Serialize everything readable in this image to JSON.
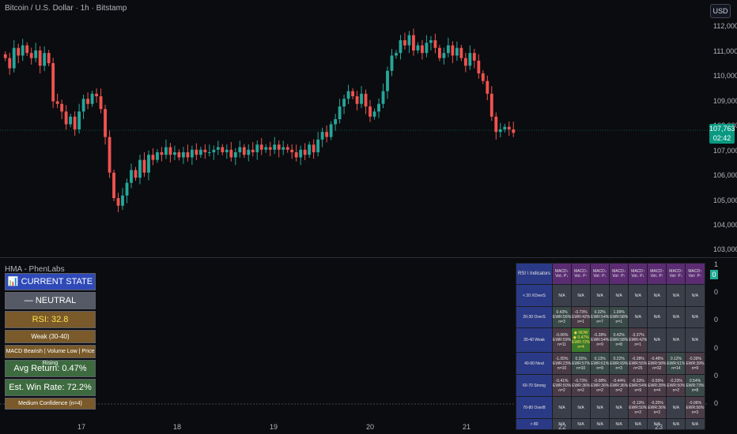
{
  "symbol": {
    "title": "Bitcoin / U.S. Dollar · 1h · Bitstamp",
    "currency": "USD"
  },
  "price_scale": {
    "ticks": [
      "112,000",
      "111,000",
      "110,000",
      "109,000",
      "108,000",
      "107,000",
      "106,000",
      "105,000",
      "104,000",
      "103,000"
    ],
    "last_price": "107,763",
    "countdown": "02:42"
  },
  "time_axis": {
    "ticks": [
      "17",
      "18",
      "19",
      "20",
      "21",
      "22",
      "23"
    ]
  },
  "indicator": {
    "title": "HMA - PhenLabs",
    "scale_ticks": [
      "1",
      "0",
      "0",
      "0",
      "0",
      "0",
      "0"
    ],
    "scale_badge": "0"
  },
  "state_panel": {
    "current_state": "📊 CURRENT STATE",
    "neutral": "— NEUTRAL",
    "rsi": "RSI: 32.8",
    "weak": "Weak (30-40)",
    "conditions": "MACD Bearish | Volume Low | Price Rising",
    "avg_return": "Avg Return: 0.47%",
    "win_rate": "Est. Win Rate: 72.2%",
    "confidence": "Medium Confidence (n=4)"
  },
  "matrix": {
    "corner": "RSI \\ Indicators",
    "columns": [
      "MACD↓ Vol↓ P↓",
      "MACD↓ Vol↓ P↑",
      "MACD↓ Vol↑ P↓",
      "MACD↓ Vol↑ P↑",
      "MACD↑ Vol↓ P↓",
      "MACD↑ Vol↓ P↑",
      "MACD↑ Vol↑ P↓",
      "MACD↑ Vol↑ P↑"
    ],
    "rows": [
      {
        "label": "< 20 XOverS",
        "cells": [
          "N/A",
          "N/A",
          "N/A",
          "N/A",
          "N/A",
          "N/A",
          "N/A",
          "N/A"
        ]
      },
      {
        "label": "20-30 OverS",
        "cells": [
          "0.43% EWR:56% n=3",
          "-0.73% EWR:42% n=1",
          "0.32% EWR:54% n=7",
          "1.99% EWR:58% n=1",
          "N/A",
          "N/A",
          "N/A",
          "N/A"
        ]
      },
      {
        "label": "30-40 Weak",
        "cells": [
          "-0.06% EWR:59% n=11",
          "◉ NOW ◉ 0.47% EWR:72% n=4",
          "-0.28% EWR:54% n=9",
          "0.42% EWR:58% n=8",
          "-3.37% EWR:42% n=1",
          "N/A",
          "N/A",
          "N/A"
        ]
      },
      {
        "label": "40-60 Neut",
        "cells": [
          "-1.05% EWR:23% n=10",
          "0.35% EWR:57% n=10",
          "0.13% EWR:61% n=9",
          "0.22% EWR:69% n=3",
          "-0.28% EWR:55% n=25",
          "-0.48% EWR:58% n=32",
          "0.12% EWR:61% n=14",
          "-0.39% EWR:39% n=9"
        ]
      },
      {
        "label": "60-70 Strong",
        "cells": [
          "-0.41% EWR:50% n=2",
          "-0.73% EWR:36% n=2",
          "-0.08% EWR:36% n=2",
          "-0.44% EWR:36% n=2",
          "-0.33% EWR:54% n=9",
          "-0.59% EWR:28% n=4",
          "-0.23% EWR:50% n=2",
          "0.54% EWR:73% n=8"
        ]
      },
      {
        "label": "70-80 OverB",
        "cells": [
          "N/A",
          "N/A",
          "N/A",
          "N/A",
          "-0.13% EWR:50% n=2",
          "-0.25% EWR:36% n=2",
          "N/A",
          "-0.06% EWR:56% n=3"
        ]
      },
      {
        "label": "> 80",
        "cells": [
          "N/A",
          "N/A",
          "N/A",
          "N/A",
          "N/A",
          "N/A",
          "N/A",
          "N/A"
        ]
      }
    ]
  },
  "colors": {
    "up": "#26a69a",
    "down": "#ef5350",
    "background": "#0b0c0f",
    "last_price": "#089981"
  },
  "chart_data": {
    "type": "candlestick",
    "x_ticks": [
      "17",
      "18",
      "19",
      "20",
      "21",
      "22",
      "23"
    ],
    "ylim": [
      103000,
      112300
    ],
    "last_price": 107763,
    "close_path": [
      110700,
      110300,
      111100,
      110800,
      111200,
      110900,
      110700,
      111000,
      110400,
      110900,
      110500,
      109000,
      108900,
      108600,
      108100,
      108400,
      107900,
      108600,
      109100,
      108900,
      109300,
      109200,
      108700,
      107600,
      106200,
      105200,
      104900,
      105300,
      105800,
      106300,
      106000,
      106700,
      106200,
      106900,
      106700,
      107000,
      106900,
      107200,
      106900,
      107000,
      106800,
      107000,
      106800,
      107100,
      106900,
      107100,
      107000,
      107000,
      107100,
      107200,
      107000,
      107100,
      106800,
      107000,
      107200,
      106900,
      107100,
      107000,
      107300,
      107100,
      107200,
      107100,
      107300,
      107100,
      107200,
      107100,
      107000,
      106800,
      107100,
      106900,
      107300,
      107000,
      107500,
      107800,
      107600,
      108100,
      108300,
      108800,
      109100,
      109400,
      109200,
      108900,
      109300,
      108800,
      108400,
      108600,
      108900,
      109400,
      110200,
      110800,
      110900,
      111400,
      111200,
      111600,
      111000,
      111200,
      110900,
      111300,
      111400,
      111100,
      110700,
      110900,
      111200,
      110800,
      111100,
      110700,
      110400,
      110900,
      110600,
      110100,
      109800,
      109300,
      108400,
      107800,
      107900,
      108000,
      107900,
      107763
    ]
  }
}
